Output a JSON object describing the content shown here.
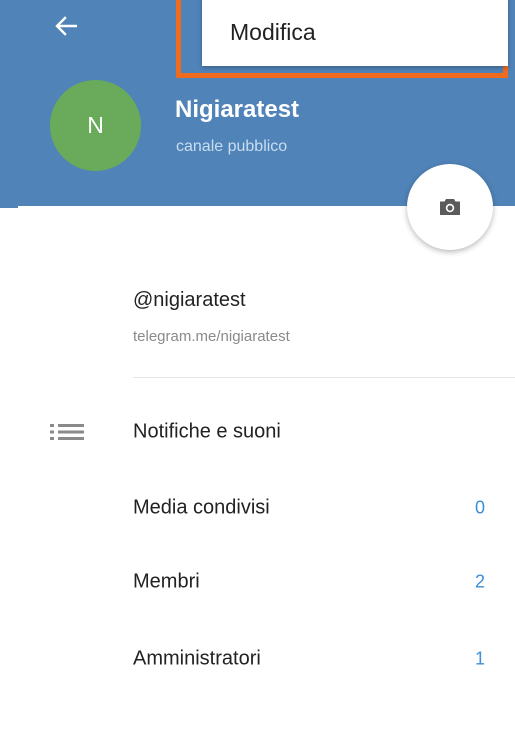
{
  "toolbar": {
    "back_icon": "arrow-back-icon"
  },
  "menu": {
    "edit_label": "Modifica"
  },
  "channel": {
    "avatar_letter": "N",
    "avatar_color": "#69ab5a",
    "name": "Nigiaratest",
    "status": "canale pubblico",
    "camera_icon": "camera-icon"
  },
  "info": {
    "username": "@nigiaratest",
    "link": "telegram.me/nigiaratest"
  },
  "settings": {
    "notifications_icon": "list-icon",
    "notifications_label": "Notifiche e suoni",
    "shared_media_label": "Media condivisi",
    "shared_media_count": "0",
    "members_label": "Membri",
    "members_count": "2",
    "admins_label": "Amministratori",
    "admins_count": "1"
  },
  "colors": {
    "header": "#5083b8",
    "highlight": "#f06b1e",
    "accent": "#3d8fd6"
  }
}
